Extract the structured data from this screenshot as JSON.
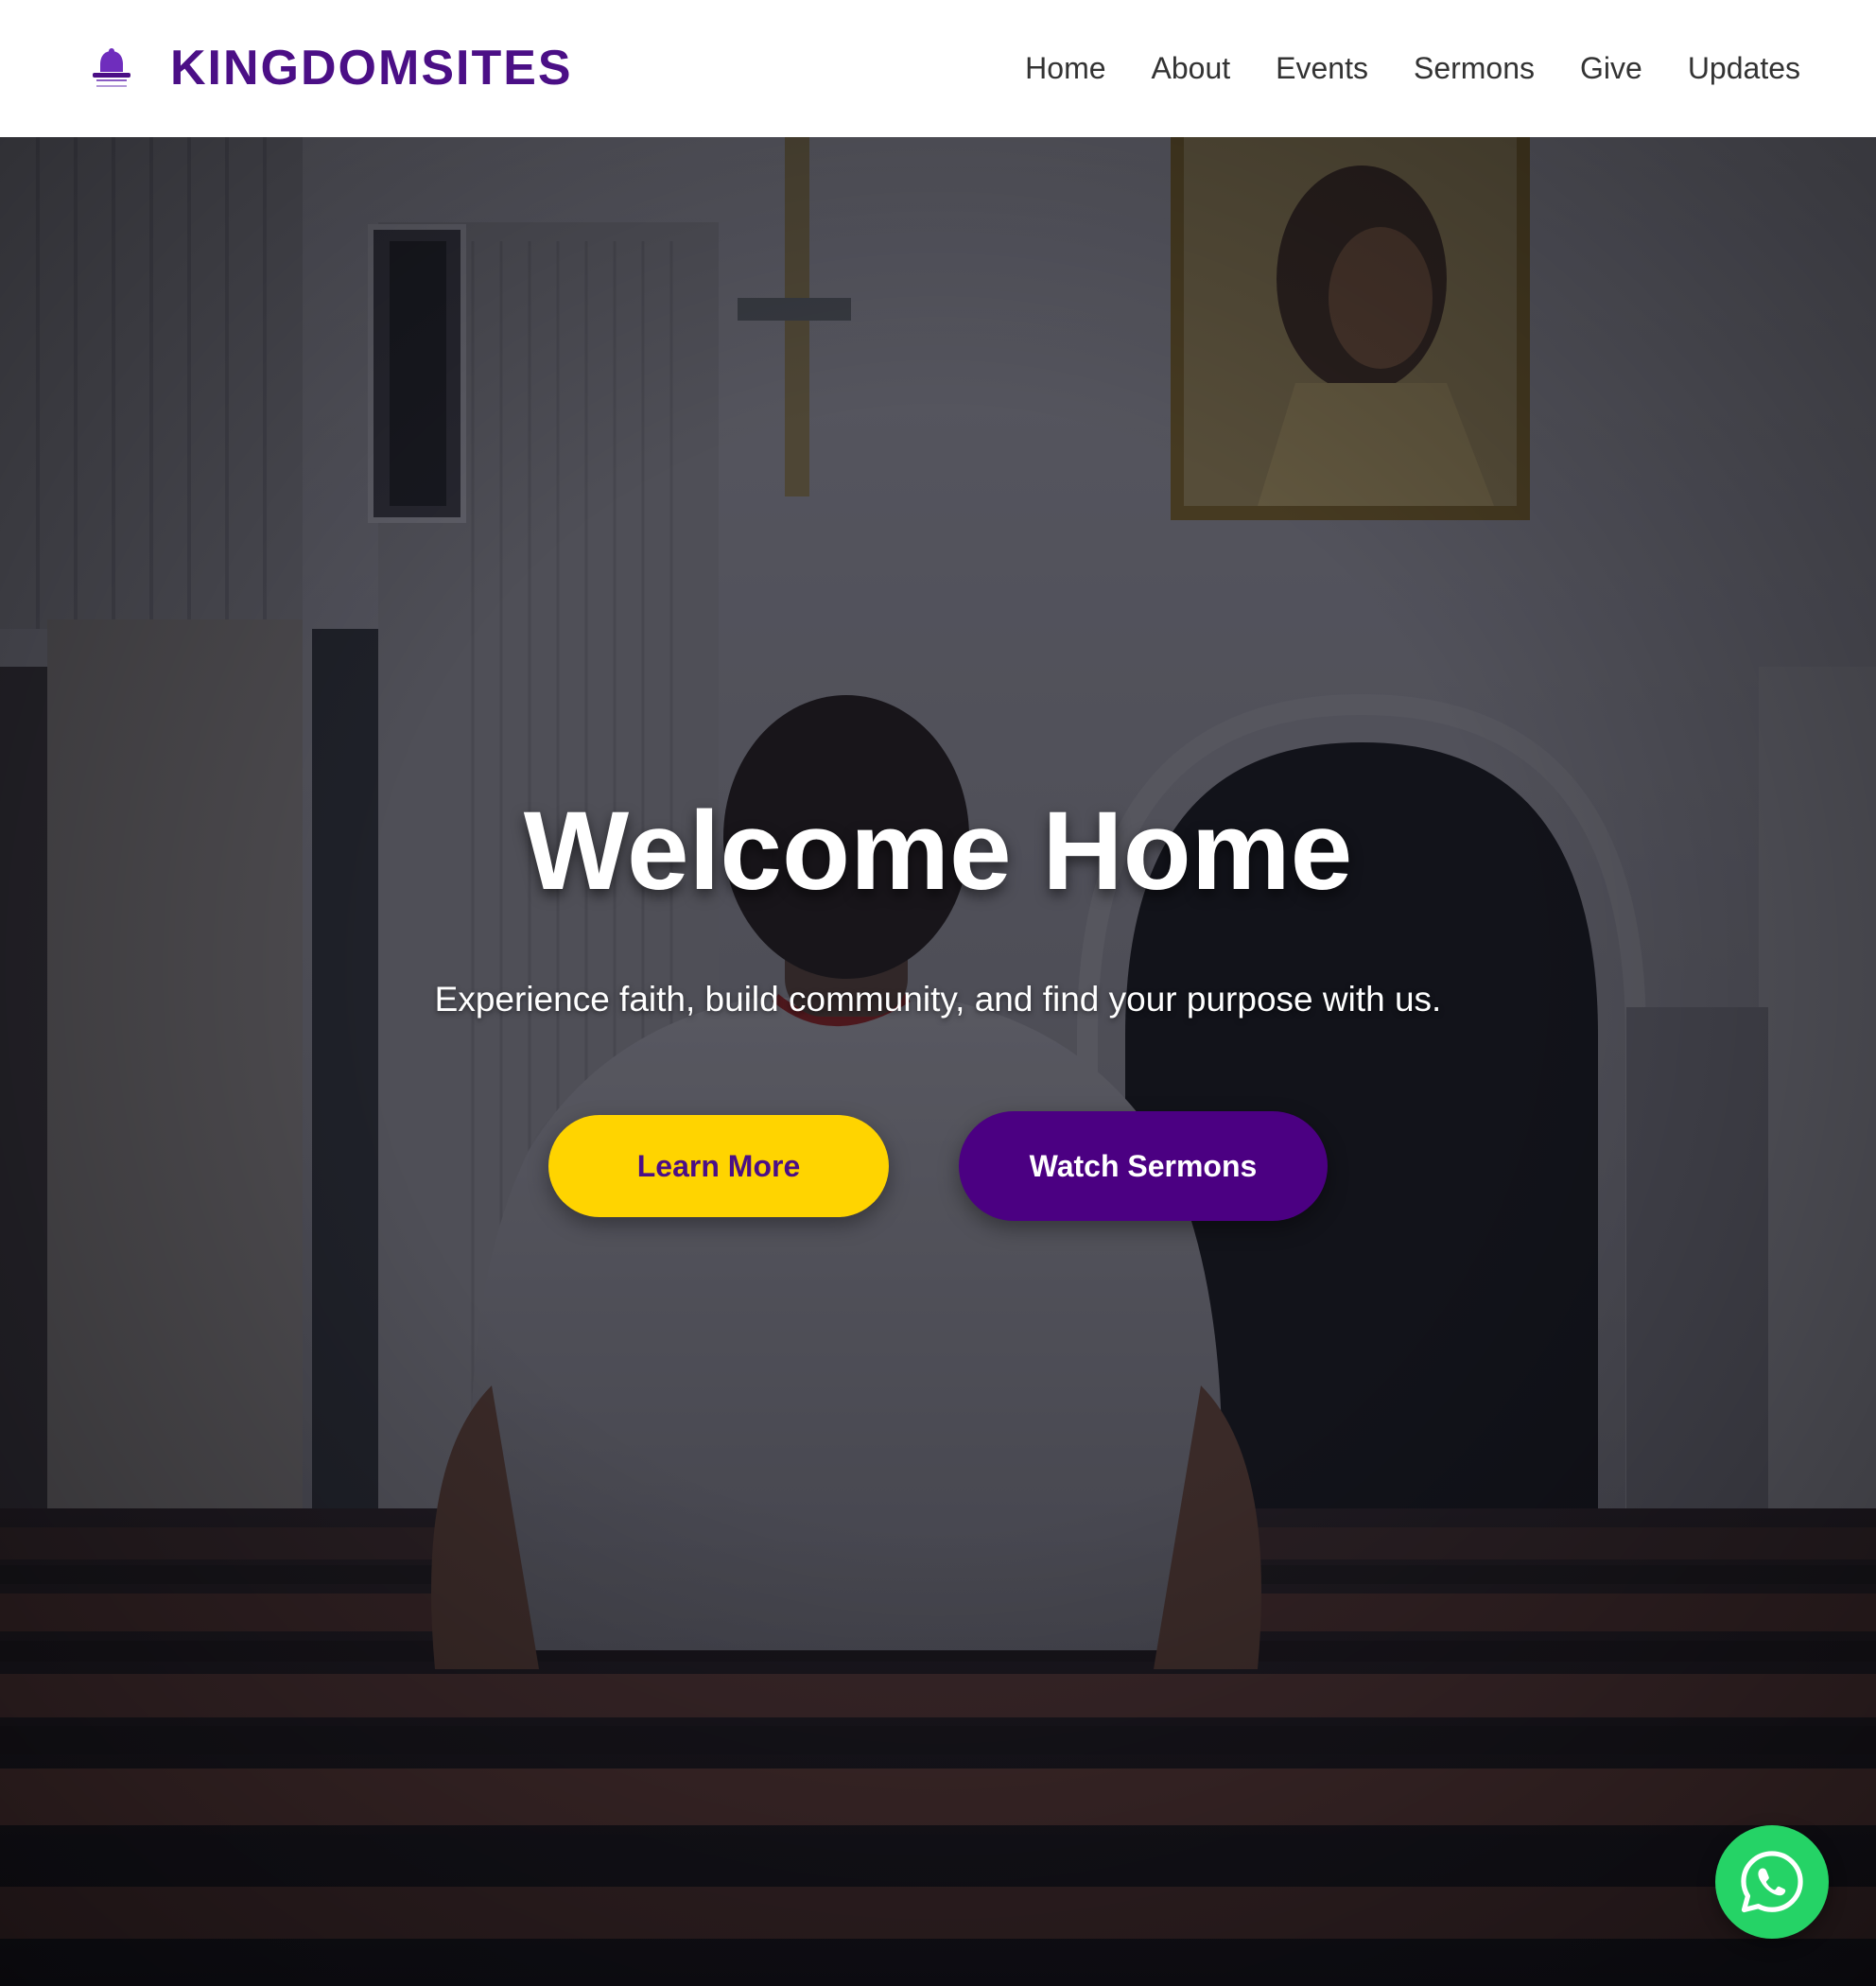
{
  "header": {
    "brand": "KINGDOMSITES",
    "logo_icon": "church-bell-logo-icon",
    "nav": [
      {
        "label": "Home"
      },
      {
        "label": "About"
      },
      {
        "label": "Events"
      },
      {
        "label": "Sermons"
      },
      {
        "label": "Give"
      },
      {
        "label": "Updates"
      }
    ]
  },
  "hero": {
    "title": "Welcome Home",
    "subtitle": "Experience faith, build community, and find your purpose with us.",
    "buttons": {
      "learn_more": "Learn More",
      "watch_sermons": "Watch Sermons"
    }
  },
  "floating": {
    "whatsapp_icon": "whatsapp-icon"
  },
  "colors": {
    "brand_purple": "#4b0f86",
    "button_yellow": "#ffd400",
    "button_purple": "#4b0082",
    "whatsapp_green": "#25d366"
  }
}
